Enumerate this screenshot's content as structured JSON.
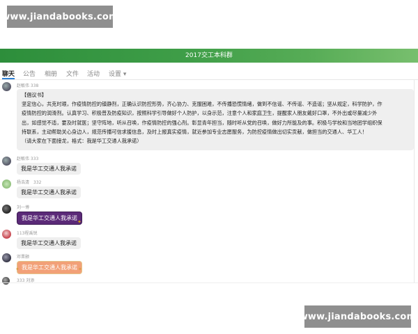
{
  "watermark": {
    "top": "www.jiandabooks.com",
    "bottom": "www.jiandabooks.com"
  },
  "group": {
    "title": "2017交工本科群"
  },
  "tabs": [
    {
      "label": "聊天",
      "active": true
    },
    {
      "label": "公告",
      "active": false
    },
    {
      "label": "相册",
      "active": false
    },
    {
      "label": "文件",
      "active": false
    },
    {
      "label": "活动",
      "active": false
    },
    {
      "label": "设置 ▾",
      "active": false
    }
  ],
  "messages": [
    {
      "sender": "赵敏伟 338",
      "lines": [
        "【倡议书】",
        "坚定信心，共克时艰，作疫情防控的镇静剂，正确认识防控形势，齐心协力、克服困难，不传播恐慌情绪，做到不信谣、不传谣、不造谣；坚从规定，科学防护，作",
        "疫情防控的润滑剂。认真学习、积极普及防疫知识，按照科学引导做好个人防护，以身示范，注意个人和家庭卫生，提醒家人朋友戴好口罩，不外出或尽量减少外",
        "出，如感觉不适，要及时就医；坚守阵地，听从召唤，作疫情防控的强心剂。彰显青年担当，随时听从党的召唤，做好力所能及的事。积极与学校和当地团学组织保",
        "持联系，主动帮助关心身边人，规范传播可信求援信息，及时上报真实疫情，就近参加专业志愿服务，为防控疫情做出切实贡献，做担当的交通人、华工人！",
        "（请大家在下面接龙，格式：我是华工交通人我承诺）"
      ]
    },
    {
      "sender": "赵敏伟 333",
      "text": "我是华工交通人我承诺"
    },
    {
      "sender": "杨浩清　332",
      "text": "我是华工交通人我承诺"
    },
    {
      "sender": "刘一博",
      "text": "我是华工交通人我承诺"
    },
    {
      "sender": "113程禹锐",
      "text": "我是华工交通人我承诺"
    },
    {
      "sender": "邓晋颢",
      "text": "我是华工交通人我承诺"
    },
    {
      "sender": "333 刘添"
    }
  ]
}
